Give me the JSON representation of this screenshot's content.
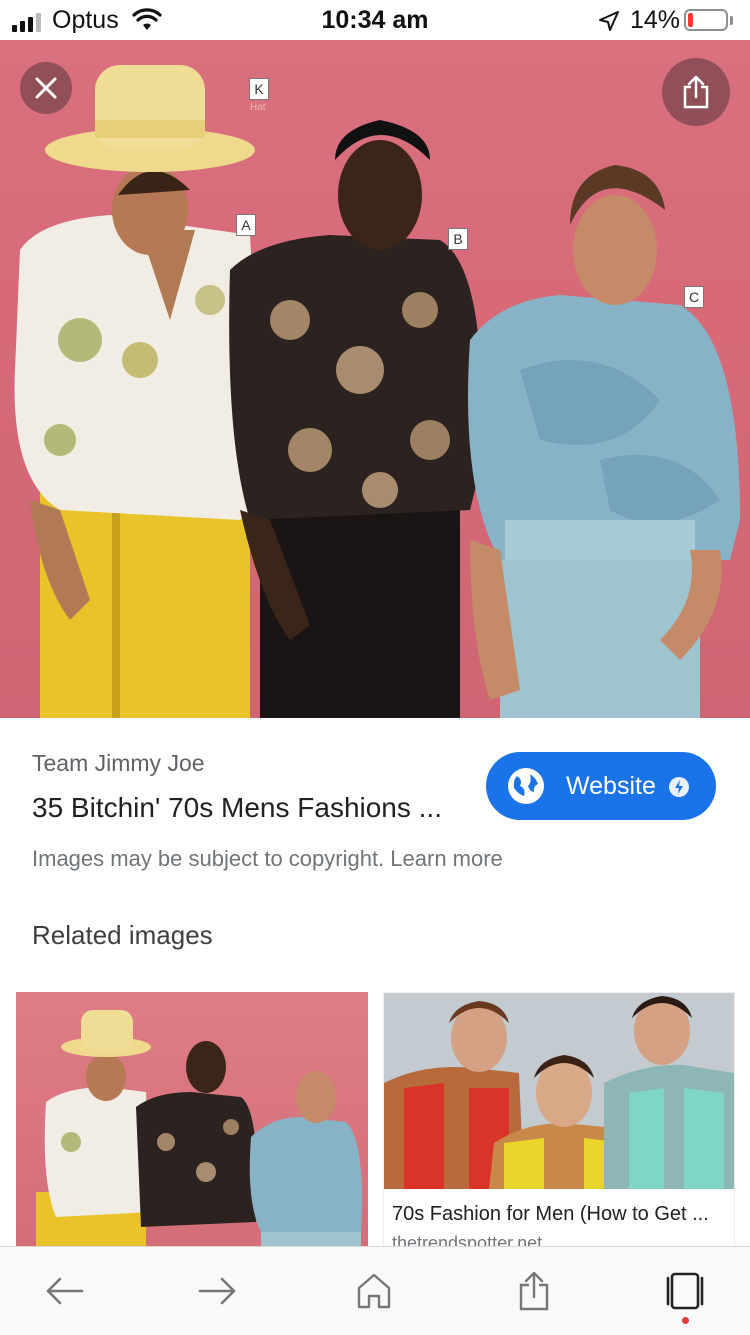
{
  "status_bar": {
    "carrier": "Optus",
    "time": "10:34 am",
    "battery_percent": "14%",
    "battery_level": 0.14,
    "battery_color": "#ff3b30"
  },
  "viewer": {
    "close_icon": "close-icon",
    "share_icon": "share-icon",
    "image_tags": [
      "K",
      "A",
      "B",
      "C"
    ],
    "image_tag_sub": "Hat"
  },
  "result": {
    "source": "Team Jimmy Joe",
    "title": "35 Bitchin' 70s Mens Fashions ...",
    "website_button": "Website",
    "copyright": "Images may be subject to copyright. Learn more",
    "accent": "#1a73e8"
  },
  "related": {
    "heading": "Related images",
    "items": [
      {
        "caption": "",
        "domain": ""
      },
      {
        "caption": "70s Fashion for Men (How to Get ...",
        "domain": "thetrendspotter.net"
      }
    ]
  },
  "toolbar": {
    "icons": [
      "back-arrow-icon",
      "forward-arrow-icon",
      "home-icon",
      "share-icon",
      "tabs-icon"
    ]
  }
}
